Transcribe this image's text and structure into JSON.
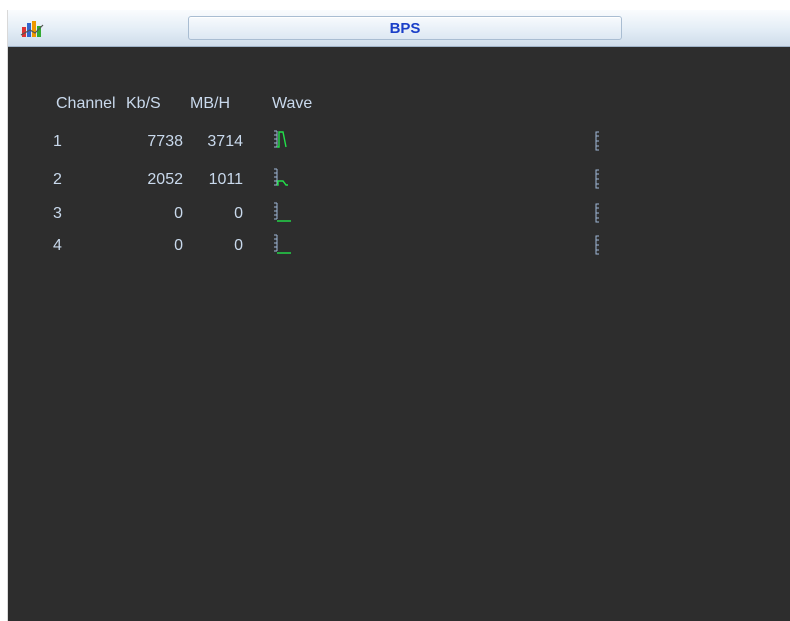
{
  "window": {
    "title": "BPS",
    "icon": "app-icon"
  },
  "table": {
    "headers": {
      "channel": "Channel",
      "kbs": "Kb/S",
      "mbh": "MB/H",
      "wave": "Wave"
    },
    "rows": [
      {
        "channel": "1",
        "kbs": "7738",
        "mbh": "3714",
        "wave_shape": "high-drop"
      },
      {
        "channel": "2",
        "kbs": "2052",
        "mbh": "1011",
        "wave_shape": "step-down"
      },
      {
        "channel": "3",
        "kbs": "0",
        "mbh": "0",
        "wave_shape": "flat"
      },
      {
        "channel": "4",
        "kbs": "0",
        "mbh": "0",
        "wave_shape": "flat"
      }
    ]
  },
  "colors": {
    "background": "#2d2d2d",
    "text": "#c9d9ec",
    "title": "#1a3fc8",
    "wave": "#22e04a",
    "wave_axis": "#9fb8d6"
  }
}
